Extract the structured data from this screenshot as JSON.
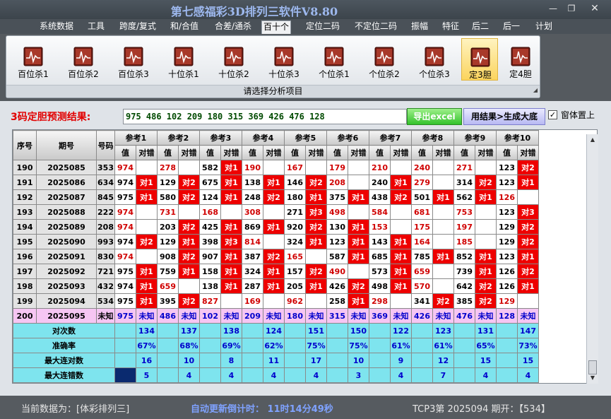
{
  "app": {
    "title": "第七感福彩3D排列三软件V8.80"
  },
  "menu": [
    {
      "label": "系统数据"
    },
    {
      "label": "工具"
    },
    {
      "label": "跨度/复式"
    },
    {
      "label": "和/合值"
    },
    {
      "label": "合差/通杀"
    },
    {
      "label": "百十个"
    },
    {
      "label": "定位二码"
    },
    {
      "label": "不定位二码"
    },
    {
      "label": "振幅"
    },
    {
      "label": "特征"
    },
    {
      "label": "后二"
    },
    {
      "label": "后一"
    },
    {
      "label": "计划"
    }
  ],
  "active_tab": "百十个",
  "ribbon": {
    "buttons": [
      {
        "label": "百位杀1"
      },
      {
        "label": "百位杀2"
      },
      {
        "label": "百位杀3"
      },
      {
        "label": "十位杀1"
      },
      {
        "label": "十位杀2"
      },
      {
        "label": "十位杀3"
      },
      {
        "label": "个位杀1"
      },
      {
        "label": "个位杀2"
      },
      {
        "label": "个位杀3"
      },
      {
        "label": "定3胆"
      },
      {
        "label": "定4胆"
      }
    ],
    "footer": "请选择分析项目"
  },
  "result": {
    "label": "3码定胆预测结果:",
    "value": "975 486 102 209 180 315 369 426 476 128",
    "excel_button": "导出excel",
    "gen_button": "用结果>生成大底",
    "checkbox_label": "窗体置上",
    "checkbox_checked": true
  },
  "table": {
    "col_headers": [
      "序号",
      "期号",
      "号码"
    ],
    "ref_headers": [
      "参考1",
      "参考2",
      "参考3",
      "参考4",
      "参考5",
      "参考6",
      "参考7",
      "参考8",
      "参考9",
      "参考10"
    ],
    "sub_val": "值",
    "sub_dc": "对错",
    "rows": [
      {
        "seq": "190",
        "period": "2025085",
        "num": "353",
        "refs": [
          [
            "974",
            ""
          ],
          [
            "278",
            ""
          ],
          [
            "582",
            "对1"
          ],
          [
            "190",
            ""
          ],
          [
            "167",
            ""
          ],
          [
            "179",
            ""
          ],
          [
            "210",
            ""
          ],
          [
            "240",
            ""
          ],
          [
            "271",
            ""
          ],
          [
            "123",
            "对2"
          ]
        ]
      },
      {
        "seq": "191",
        "period": "2025086",
        "num": "634",
        "refs": [
          [
            "974",
            "对1"
          ],
          [
            "129",
            "对2"
          ],
          [
            "675",
            "对1"
          ],
          [
            "138",
            "对1"
          ],
          [
            "146",
            "对2"
          ],
          [
            "208",
            ""
          ],
          [
            "240",
            "对1"
          ],
          [
            "279",
            ""
          ],
          [
            "314",
            "对2"
          ],
          [
            "123",
            "对1"
          ]
        ]
      },
      {
        "seq": "192",
        "period": "2025087",
        "num": "845",
        "refs": [
          [
            "975",
            "对1"
          ],
          [
            "580",
            "对2"
          ],
          [
            "124",
            "对1"
          ],
          [
            "248",
            "对2"
          ],
          [
            "180",
            "对1"
          ],
          [
            "375",
            "对1"
          ],
          [
            "438",
            "对2"
          ],
          [
            "501",
            "对1"
          ],
          [
            "562",
            "对1"
          ],
          [
            "126",
            ""
          ]
        ]
      },
      {
        "seq": "193",
        "period": "2025088",
        "num": "222",
        "refs": [
          [
            "974",
            ""
          ],
          [
            "731",
            ""
          ],
          [
            "168",
            ""
          ],
          [
            "308",
            ""
          ],
          [
            "271",
            "对3"
          ],
          [
            "498",
            ""
          ],
          [
            "584",
            ""
          ],
          [
            "681",
            ""
          ],
          [
            "753",
            ""
          ],
          [
            "123",
            "对3"
          ]
        ]
      },
      {
        "seq": "194",
        "period": "2025089",
        "num": "208",
        "refs": [
          [
            "974",
            ""
          ],
          [
            "203",
            "对2"
          ],
          [
            "425",
            "对1"
          ],
          [
            "869",
            "对1"
          ],
          [
            "920",
            "对2"
          ],
          [
            "130",
            "对1"
          ],
          [
            "153",
            ""
          ],
          [
            "175",
            ""
          ],
          [
            "197",
            ""
          ],
          [
            "129",
            "对2"
          ]
        ]
      },
      {
        "seq": "195",
        "period": "2025090",
        "num": "993",
        "refs": [
          [
            "974",
            "对2"
          ],
          [
            "129",
            "对1"
          ],
          [
            "398",
            "对3"
          ],
          [
            "814",
            ""
          ],
          [
            "324",
            "对1"
          ],
          [
            "123",
            "对1"
          ],
          [
            "143",
            "对1"
          ],
          [
            "164",
            ""
          ],
          [
            "185",
            ""
          ],
          [
            "129",
            "对2"
          ]
        ]
      },
      {
        "seq": "196",
        "period": "2025091",
        "num": "830",
        "refs": [
          [
            "974",
            ""
          ],
          [
            "908",
            "对2"
          ],
          [
            "907",
            "对1"
          ],
          [
            "387",
            "对2"
          ],
          [
            "165",
            ""
          ],
          [
            "587",
            "对1"
          ],
          [
            "685",
            "对1"
          ],
          [
            "785",
            "对1"
          ],
          [
            "852",
            "对1"
          ],
          [
            "123",
            "对1"
          ]
        ]
      },
      {
        "seq": "197",
        "period": "2025092",
        "num": "721",
        "refs": [
          [
            "975",
            "对1"
          ],
          [
            "759",
            "对1"
          ],
          [
            "158",
            "对1"
          ],
          [
            "324",
            "对1"
          ],
          [
            "157",
            "对2"
          ],
          [
            "490",
            ""
          ],
          [
            "573",
            "对1"
          ],
          [
            "659",
            ""
          ],
          [
            "739",
            "对1"
          ],
          [
            "126",
            "对2"
          ]
        ]
      },
      {
        "seq": "198",
        "period": "2025093",
        "num": "432",
        "refs": [
          [
            "974",
            "对1"
          ],
          [
            "659",
            ""
          ],
          [
            "138",
            "对1"
          ],
          [
            "287",
            "对1"
          ],
          [
            "205",
            "对1"
          ],
          [
            "426",
            "对2"
          ],
          [
            "498",
            "对1"
          ],
          [
            "570",
            ""
          ],
          [
            "642",
            "对2"
          ],
          [
            "126",
            "对1"
          ]
        ]
      },
      {
        "seq": "199",
        "period": "2025094",
        "num": "534",
        "refs": [
          [
            "975",
            "对1"
          ],
          [
            "395",
            "对2"
          ],
          [
            "827",
            ""
          ],
          [
            "169",
            ""
          ],
          [
            "962",
            ""
          ],
          [
            "258",
            "对1"
          ],
          [
            "298",
            ""
          ],
          [
            "341",
            "对2"
          ],
          [
            "385",
            "对2"
          ],
          [
            "129",
            ""
          ]
        ]
      }
    ],
    "pred_row": {
      "seq": "200",
      "period": "2025095",
      "num": "未知",
      "refs": [
        "975",
        "486",
        "102",
        "209",
        "180",
        "315",
        "369",
        "426",
        "476",
        "128"
      ],
      "unknown": "未知"
    },
    "stats": [
      {
        "label": "对次数",
        "values": [
          "134",
          "137",
          "138",
          "124",
          "151",
          "150",
          "122",
          "123",
          "131",
          "147"
        ]
      },
      {
        "label": "准确率",
        "values": [
          "67%",
          "68%",
          "69%",
          "62%",
          "75%",
          "75%",
          "61%",
          "61%",
          "65%",
          "73%"
        ]
      },
      {
        "label": "最大连对数",
        "values": [
          "16",
          "10",
          "8",
          "11",
          "17",
          "10",
          "9",
          "12",
          "15",
          "15"
        ]
      },
      {
        "label": "最大连错数",
        "values": [
          "5",
          "4",
          "4",
          "4",
          "4",
          "3",
          "4",
          "7",
          "4",
          "4"
        ]
      }
    ]
  },
  "status": {
    "current_data": "当前数据为：[体彩排列三]",
    "countdown": "自动更新倒计时：  11时14分49秒",
    "draw_info": "TCP3第 2025094 期开：【534】"
  },
  "colors": {
    "hit": "#ee0000",
    "predict_row": "#f6c6f3",
    "stats": "#7ee4ee",
    "result_label": "#e20000"
  },
  "icons": {
    "ribbon": "chart-icon",
    "scroll_up": "arrow-up-icon",
    "scroll_down": "arrow-down-icon"
  }
}
